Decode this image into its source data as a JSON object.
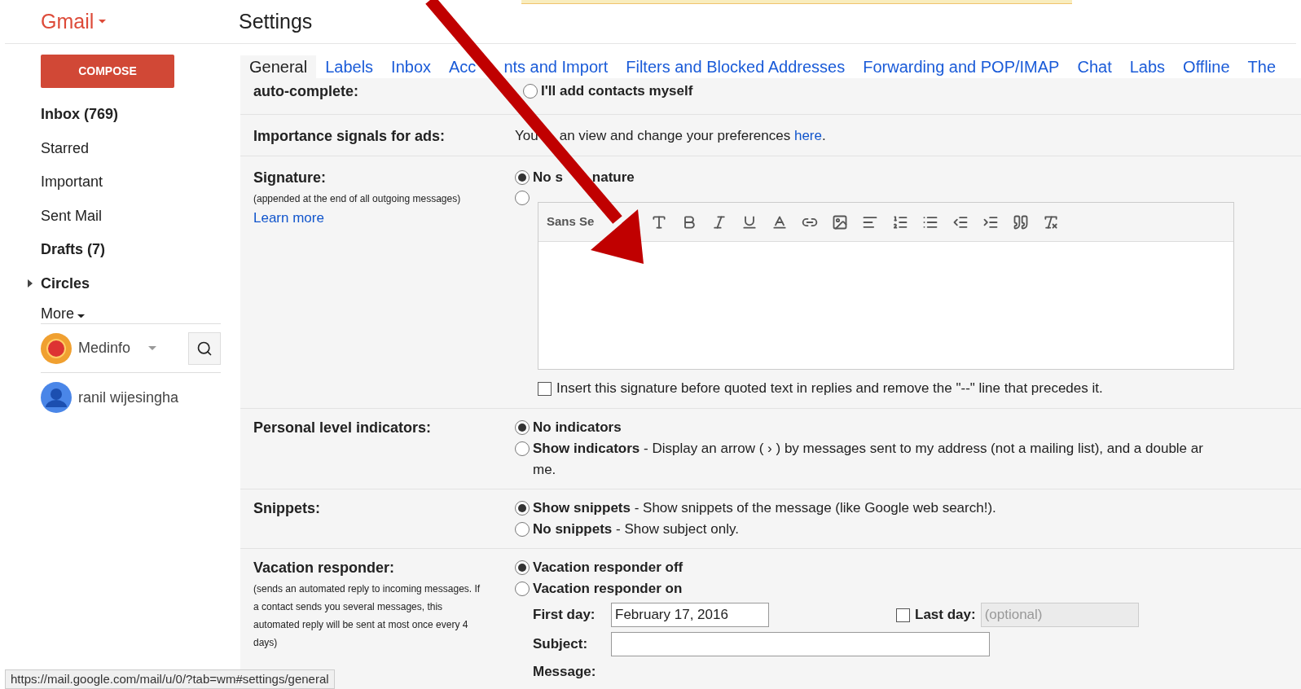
{
  "header": {
    "brand": "Gmail",
    "title": "Settings"
  },
  "compose": "COMPOSE",
  "nav": [
    {
      "label": "Inbox (769)",
      "kind": "item",
      "unread": true
    },
    {
      "label": "Starred",
      "kind": "item",
      "unread": false
    },
    {
      "label": "Important",
      "kind": "item",
      "unread": false
    },
    {
      "label": "Sent Mail",
      "kind": "item",
      "unread": false
    },
    {
      "label": "Drafts (7)",
      "kind": "item",
      "unread": true
    },
    {
      "label": "Circles",
      "kind": "group",
      "unread": true
    },
    {
      "label": "More",
      "kind": "more",
      "unread": false
    }
  ],
  "accounts": [
    {
      "name": "Medinfo",
      "kind": "brand"
    },
    {
      "name": "ranil wijesingha",
      "kind": "person"
    }
  ],
  "tabs": [
    {
      "label": "General",
      "selected": true
    },
    {
      "label": "Labels",
      "selected": false
    },
    {
      "label": "Inbox",
      "selected": false
    },
    {
      "label": "Acc",
      "label_after": "nts and Import",
      "selected": false
    },
    {
      "label": "Filters and Blocked Addresses",
      "selected": false
    },
    {
      "label": "Forwarding and POP/IMAP",
      "selected": false
    },
    {
      "label": "Chat",
      "selected": false
    },
    {
      "label": "Labs",
      "selected": false
    },
    {
      "label": "Offline",
      "selected": false
    },
    {
      "label": "The",
      "selected": false
    }
  ],
  "rows": [
    {
      "kind": "options",
      "label": "auto-complete:",
      "options": [
        {
          "label": "I'll add contacts myself",
          "selected": false
        }
      ]
    },
    {
      "kind": "text",
      "label": "Importance signals for ads:",
      "text": "You",
      "text_after": "an view and change your preferences ",
      "link": "here",
      "after": "."
    },
    {
      "kind": "signature",
      "label": "Signature:",
      "note": "(appended at the end of all outgoing messages)",
      "note_link": "Learn more",
      "options": [
        {
          "label": "No s",
          "label_after": "nature",
          "selected": true
        },
        {
          "selected": false
        }
      ],
      "editor": {
        "font": "Sans Se"
      },
      "checkbox": {
        "label": "Insert this signature before quoted text in replies and remove the \"--\" line that precedes it.",
        "checked": false
      }
    },
    {
      "kind": "options",
      "label": "Personal level indicators:",
      "options": [
        {
          "label": "No indicators",
          "selected": true
        },
        {
          "label": "Show indicators",
          "desc": " - Display an arrow ( › ) by messages sent to my address (not a mailing list), and a double ar",
          "more": "me.",
          "selected": false
        }
      ]
    },
    {
      "kind": "options",
      "label": "Snippets:",
      "options": [
        {
          "label": "Show snippets",
          "desc": " - Show snippets of the message (like Google web search!).",
          "selected": true
        },
        {
          "label": "No snippets",
          "desc": " - Show subject only.",
          "selected": false
        }
      ]
    },
    {
      "kind": "vacation",
      "label": "Vacation responder:",
      "note": "(sends an automated reply to incoming messages. If a contact sends you several messages, this automated reply will be sent at most once every 4 days)",
      "options": [
        {
          "label": "Vacation responder off",
          "selected": true
        },
        {
          "label": "Vacation responder on",
          "selected": false
        }
      ],
      "first_day": {
        "label": "First day:",
        "value": "February 17, 2016"
      },
      "last_day": {
        "label": "Last day:",
        "placeholder": "(optional)",
        "checked": false
      },
      "subject": {
        "label": "Subject:"
      },
      "message": {
        "label": "Message:"
      }
    }
  ],
  "status_url": "https://mail.google.com/mail/u/0/?tab=wm#settings/general"
}
